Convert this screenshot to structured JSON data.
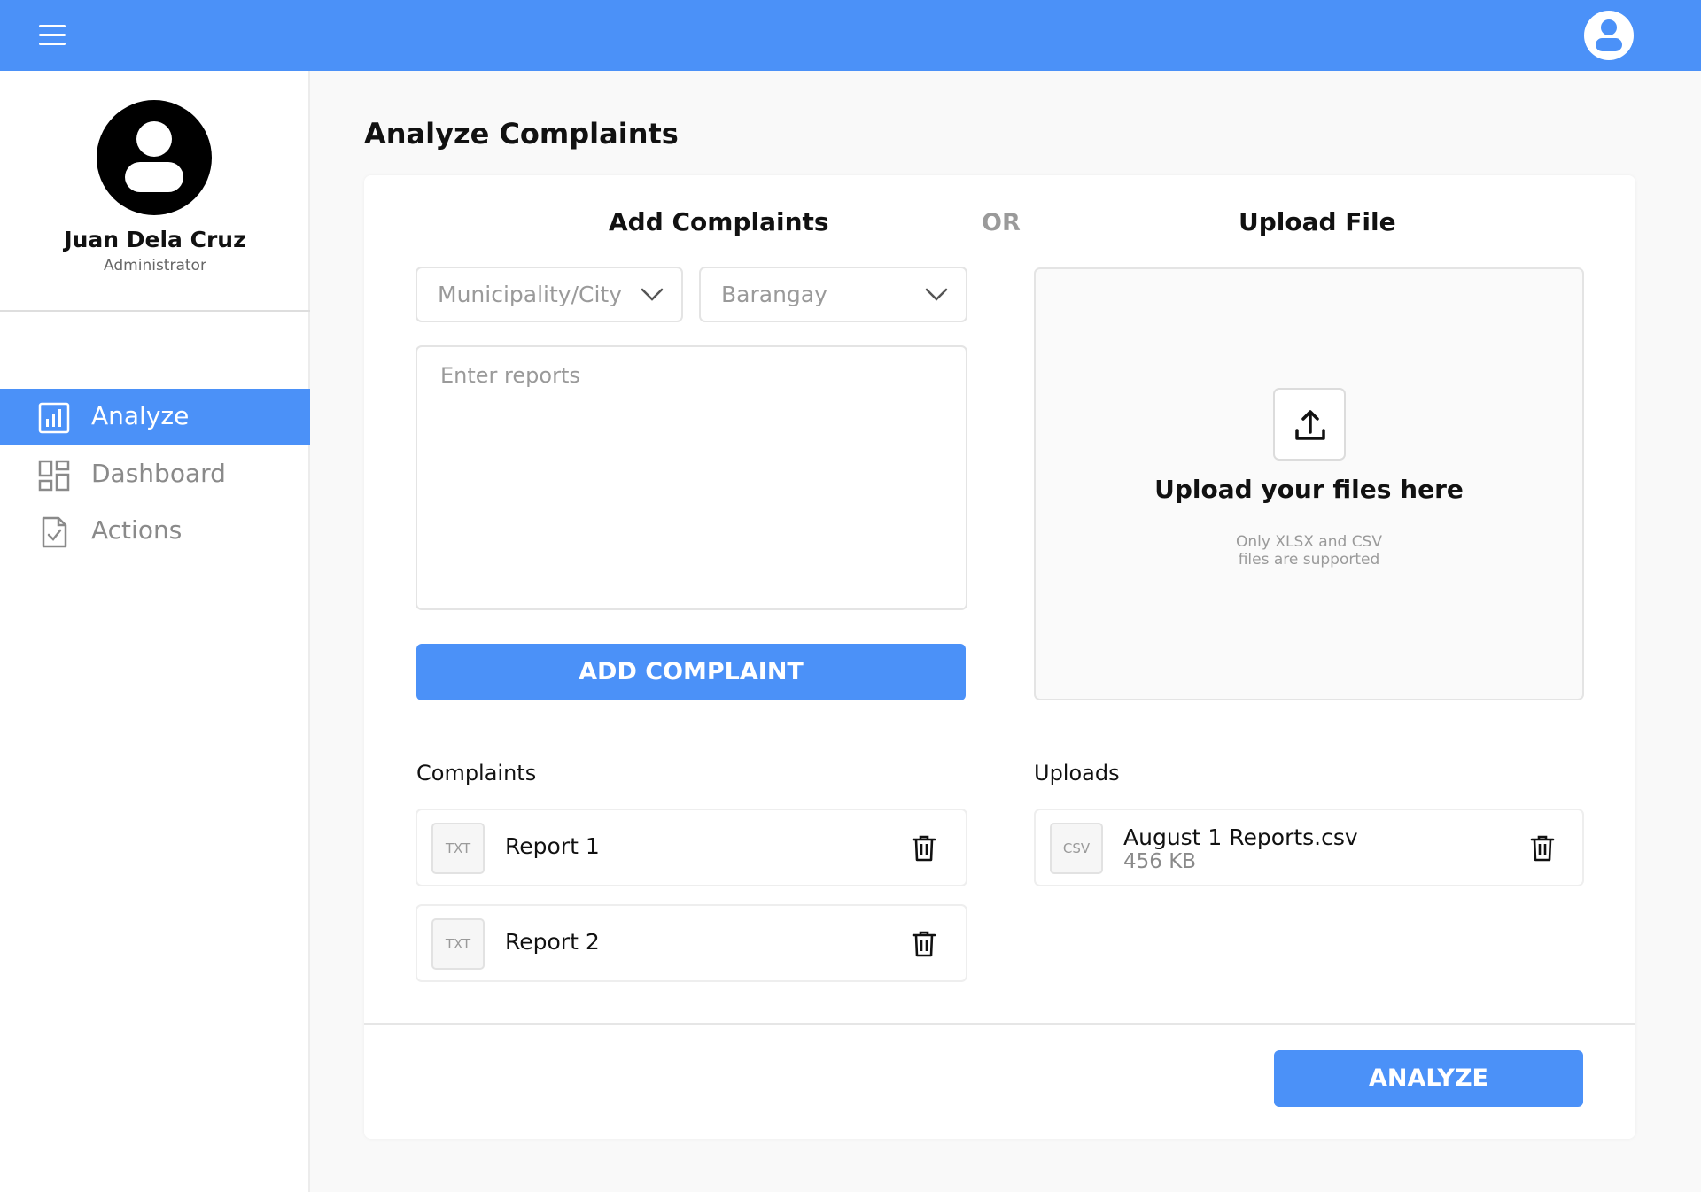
{
  "topbar": {
    "menu_icon": "hamburger-menu-icon",
    "account_icon": "user-account-icon"
  },
  "profile": {
    "name": "Juan Dela Cruz",
    "role": "Administrator",
    "avatar_icon": "user-avatar-icon"
  },
  "sidebar": {
    "items": [
      {
        "label": "Analyze",
        "icon": "analytics-chart-icon",
        "active": true
      },
      {
        "label": "Dashboard",
        "icon": "dashboard-grid-icon",
        "active": false
      },
      {
        "label": "Actions",
        "icon": "document-check-icon",
        "active": false
      }
    ]
  },
  "main": {
    "title": "Analyze Complaints",
    "add_section": {
      "title": "Add Complaints",
      "municipality_placeholder": "Municipality/City",
      "barangay_placeholder": "Barangay",
      "reports_placeholder": "Enter reports",
      "add_button": "ADD COMPLAINT"
    },
    "or_label": "OR",
    "upload_section": {
      "title": "Upload File",
      "dropzone_title": "Upload your files here",
      "dropzone_sub_line1": "Only XLSX and CSV",
      "dropzone_sub_line2": "files are supported"
    },
    "complaints": {
      "heading": "Complaints",
      "items": [
        {
          "type": "TXT",
          "name": "Report 1"
        },
        {
          "type": "TXT",
          "name": "Report 2"
        }
      ]
    },
    "uploads": {
      "heading": "Uploads",
      "items": [
        {
          "type": "CSV",
          "name": "August 1 Reports.csv",
          "size": "456 KB"
        }
      ]
    },
    "analyze_button": "ANALYZE"
  },
  "colors": {
    "accent": "#4b91f8",
    "muted_text": "#9a9a9a"
  }
}
